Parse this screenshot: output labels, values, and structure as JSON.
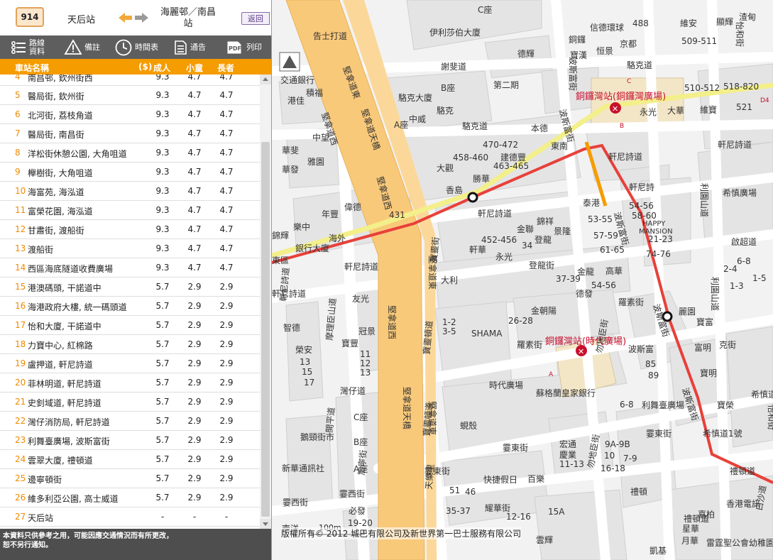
{
  "header": {
    "route": "914",
    "from_stop": "天后站",
    "to_stop": "海麗邨／南昌站",
    "back_label": "返回"
  },
  "toolbar": [
    {
      "label": "路線資料",
      "icon": "list-icon"
    },
    {
      "label": "備註",
      "icon": "warning-icon"
    },
    {
      "label": "時間表",
      "icon": "clock-icon"
    },
    {
      "label": "通告",
      "icon": "notice-icon"
    },
    {
      "label": "列印",
      "icon": "pdf-icon"
    }
  ],
  "columns": {
    "stop": "車站名稱",
    "currency": "($)",
    "adult": "成人",
    "child": "小童",
    "senior": "長者"
  },
  "fares": [
    {
      "seq": "4",
      "stop": "南昌邨, 欽州街西",
      "adult": "9.3",
      "child": "4.7",
      "senior": "4.7"
    },
    {
      "seq": "5",
      "stop": "醫局街, 欽州街",
      "adult": "9.3",
      "child": "4.7",
      "senior": "4.7"
    },
    {
      "seq": "6",
      "stop": "北河街, 荔枝角道",
      "adult": "9.3",
      "child": "4.7",
      "senior": "4.7"
    },
    {
      "seq": "7",
      "stop": "醫局街, 南昌街",
      "adult": "9.3",
      "child": "4.7",
      "senior": "4.7"
    },
    {
      "seq": "8",
      "stop": "洋松街休憩公園, 大角咀道",
      "adult": "9.3",
      "child": "4.7",
      "senior": "4.7"
    },
    {
      "seq": "9",
      "stop": "櫸樹街, 大角咀道",
      "adult": "9.3",
      "child": "4.7",
      "senior": "4.7"
    },
    {
      "seq": "10",
      "stop": "海富苑, 海泓道",
      "adult": "9.3",
      "child": "4.7",
      "senior": "4.7"
    },
    {
      "seq": "11",
      "stop": "富榮花園, 海泓道",
      "adult": "9.3",
      "child": "4.7",
      "senior": "4.7"
    },
    {
      "seq": "12",
      "stop": "甘肅街, 渡船街",
      "adult": "9.3",
      "child": "4.7",
      "senior": "4.7"
    },
    {
      "seq": "13",
      "stop": "渡船街",
      "adult": "9.3",
      "child": "4.7",
      "senior": "4.7"
    },
    {
      "seq": "14",
      "stop": "西區海底隧道收費廣場",
      "adult": "9.3",
      "child": "4.7",
      "senior": "4.7"
    },
    {
      "seq": "15",
      "stop": "港澳碼頭, 干諾道中",
      "adult": "5.7",
      "child": "2.9",
      "senior": "2.9"
    },
    {
      "seq": "16",
      "stop": "海港政府大樓, 統一碼頭道",
      "adult": "5.7",
      "child": "2.9",
      "senior": "2.9"
    },
    {
      "seq": "17",
      "stop": "怡和大廈, 干諾道中",
      "adult": "5.7",
      "child": "2.9",
      "senior": "2.9"
    },
    {
      "seq": "18",
      "stop": "力寶中心, 紅棉路",
      "adult": "5.7",
      "child": "2.9",
      "senior": "2.9"
    },
    {
      "seq": "19",
      "stop": "盧押道, 軒尼詩道",
      "adult": "5.7",
      "child": "2.9",
      "senior": "2.9"
    },
    {
      "seq": "20",
      "stop": "菲林明道, 軒尼詩道",
      "adult": "5.7",
      "child": "2.9",
      "senior": "2.9"
    },
    {
      "seq": "21",
      "stop": "史釗域道, 軒尼詩道",
      "adult": "5.7",
      "child": "2.9",
      "senior": "2.9"
    },
    {
      "seq": "22",
      "stop": "灣仔消防局, 軒尼詩道",
      "adult": "5.7",
      "child": "2.9",
      "senior": "2.9"
    },
    {
      "seq": "23",
      "stop": "利舞臺廣場, 波斯富街",
      "adult": "5.7",
      "child": "2.9",
      "senior": "2.9"
    },
    {
      "seq": "24",
      "stop": "雲翠大廈, 禮頓道",
      "adult": "5.7",
      "child": "2.9",
      "senior": "2.9"
    },
    {
      "seq": "25",
      "stop": "邊寧頓街",
      "adult": "5.7",
      "child": "2.9",
      "senior": "2.9"
    },
    {
      "seq": "26",
      "stop": "維多利亞公園, 高士威道",
      "adult": "5.7",
      "child": "2.9",
      "senior": "2.9"
    },
    {
      "seq": "27",
      "stop": "天后站",
      "adult": "-",
      "child": "-",
      "senior": "-"
    }
  ],
  "footer": {
    "line1": "本資料只供參考之用，可能因應交通情況而有所更改，",
    "line2": "恕不另行通知。"
  },
  "map": {
    "copyright": "版權所有© 2012 城巴有限公司及新世界第一巴士服務有限公司",
    "scale_label": "100m",
    "colors": {
      "route": "#e8403a",
      "tram": "#f3ef8a",
      "flyover": "#f9c97a",
      "accent": "#f59c00"
    },
    "mtr_station_1": "銅鑼灣站(銅鑼灣廣場)",
    "mtr_station_2": "銅鑼灣站(時代廣場)",
    "streets": {
      "hennessy_1": "軒尼詩道",
      "hennessy_2": "軒尼詩道",
      "hennessy_3": "軒尼詩道",
      "hennessy_4": "軒尼詩道",
      "hennessy_5": "軒尼詩道",
      "lockhart": "駱克道",
      "lockhart_2": "駱克道",
      "canal_e": "堅拿道東",
      "canal_w": "堅拿道西",
      "canal_fly": "堅拿道天橋",
      "percival": "波斯富街",
      "percival_2": "波斯富街",
      "percival_3": "波斯富街",
      "jaffe": "謝斐道",
      "gloucester": "告士打道",
      "yee_wo": "怡和街",
      "lee_garden": "利園山道",
      "lee_garden_2": "利園山道",
      "russell": "羅素街",
      "russell_2": "羅素街",
      "matheson": "勿地臣街",
      "matheson_2": "勿地臣街",
      "leighton": "禮頓道",
      "leighton_2": "禮頓道",
      "wan_chai_rd": "灣仔道",
      "bowrington": "寶靈頓道",
      "morrison": "摩理臣山道",
      "tin_lok": "天樂里",
      "sharp_st": "霎東街",
      "sharp_st_2": "霎東街",
      "sharp_st_3": "霎東街",
      "sharp_st_4": "霎西街",
      "sharp_st_5": "霎西街",
      "kai_chiu": "啟超道",
      "hysan": "希慎道",
      "yun_ping": "恩平道",
      "percival_4": "波斯富街",
      "heard": "克街",
      "bowring": "寶靈街",
      "sports": "鵝頸街市",
      "canal_e2": "堅拿道東",
      "canal_w2": "堅拿道西",
      "bowrington_2": "寶靈頓道",
      "hoi_ping": "開平道",
      "tang_lung": "登龍街",
      "yiu_wa": "耀華街",
      "percival_5": "波斯富街",
      "pak_sha": "白沙道",
      "hennessy_6": "軒尼詩道",
      "yee_wo_2": "怡和街",
      "cannon": "加寧街",
      "lan_fong": "蘭芳道"
    },
    "buildings": {
      "b1": "伊利莎伯大廈",
      "b2": "C座",
      "b3": "B座",
      "b4": "A座",
      "b5": "第二期",
      "b6": "德輝",
      "b7": "寶漢",
      "b8": "恒景",
      "b9": "京都",
      "b10": "銅鑼",
      "b11": "信德環球",
      "b12": "488",
      "b13": "維安",
      "b14": "顯輝",
      "b15": "509-511",
      "b16": "渣甸",
      "b17": "駱克大廈",
      "b18": "中威",
      "b19": "駱克",
      "b20": "交通銀行",
      "b21": "港佳",
      "b22": "積福",
      "b23": "中望",
      "b24": "華斐",
      "b25": "雅園",
      "b26": "華發",
      "b27": "470-472",
      "b28": "458-460",
      "b29": "463-465",
      "b30": "大觀",
      "b31": "建德豐",
      "b32": "勝華",
      "b33": "本德",
      "b34": "東南",
      "b35": "香島",
      "b36": "431",
      "b37": "偉德",
      "b38": "年豐",
      "b39": "樂中",
      "b40": "海外",
      "b41": "銀行大廈",
      "b42": "錦輝",
      "b43": "東區",
      "b44": "永光",
      "b45": "大華",
      "b46": "維寶",
      "b47": "510-512",
      "b48": "518-820",
      "b49": "521",
      "b50": "軒尼詩",
      "b51": "54-56",
      "b52": "58-60",
      "b53": "HAPPY",
      "b54": "MANSION",
      "b55": "21-23",
      "b56": "74-76",
      "b57": "泰港",
      "b58": "53-55",
      "b59": "57-59",
      "b60": "61-65",
      "b61": "希慎廣場",
      "b62": "錦祥",
      "b63": "金聯",
      "b64": "景隆",
      "b65": "452-456",
      "b66": "34",
      "b67": "登龍",
      "b68": "軒華",
      "b69": "永光",
      "b70": "大利",
      "b71": "37-39",
      "b72": "金龍",
      "b73": "高華",
      "b74": "德發",
      "b75": "54-56",
      "b76": "友光",
      "b77": "金朝陽",
      "b78": "智德",
      "b79": "冠景",
      "b80": "1-2",
      "b81": "3-5",
      "b82": "SHAMA",
      "b83": "26-28",
      "b84": "寶豐",
      "b85": "11",
      "b86": "12",
      "b87": "13",
      "b88": "榮安",
      "b89": "13",
      "b90": "15",
      "b91": "17",
      "b92": "時代廣場",
      "b93": "蘇格蘭皇家銀行",
      "b94": "波斯富",
      "b95": "85",
      "b96": "89",
      "b97": "6-8",
      "b98": "利舞臺廣場",
      "b99": "寶明",
      "b100": "寶榮",
      "b101": "希慎道1號",
      "b102": "麗園",
      "b103": "寶富",
      "b104": "1-3",
      "b105": "6-8",
      "b106": "2-4",
      "b107": "1-5",
      "b108": "蜆殼",
      "b109": "C座",
      "b110": "B座",
      "b111": "A座",
      "b112": "新華通訊社",
      "b113": "宏通",
      "b114": "慶業",
      "b115": "11-13",
      "b116": "9A-9B",
      "b117": "10",
      "b118": "7-9",
      "b119": "16-18",
      "b120": "禮頓",
      "b121": "快捷假日",
      "b122": "百樂",
      "b123": "51",
      "b124": "46",
      "b125": "35-37",
      "b126": "12-16",
      "b127": "15A",
      "b128": "必發",
      "b129": "19-20",
      "b130": "香港電訊",
      "b131": "嘉柏",
      "b132": "星華",
      "b133": "雲輝",
      "b134": "凱基",
      "b135": "月華",
      "b136": "雷霆聖公會幼稚園",
      "b137": "富明",
      "b138": "南洋"
    }
  }
}
